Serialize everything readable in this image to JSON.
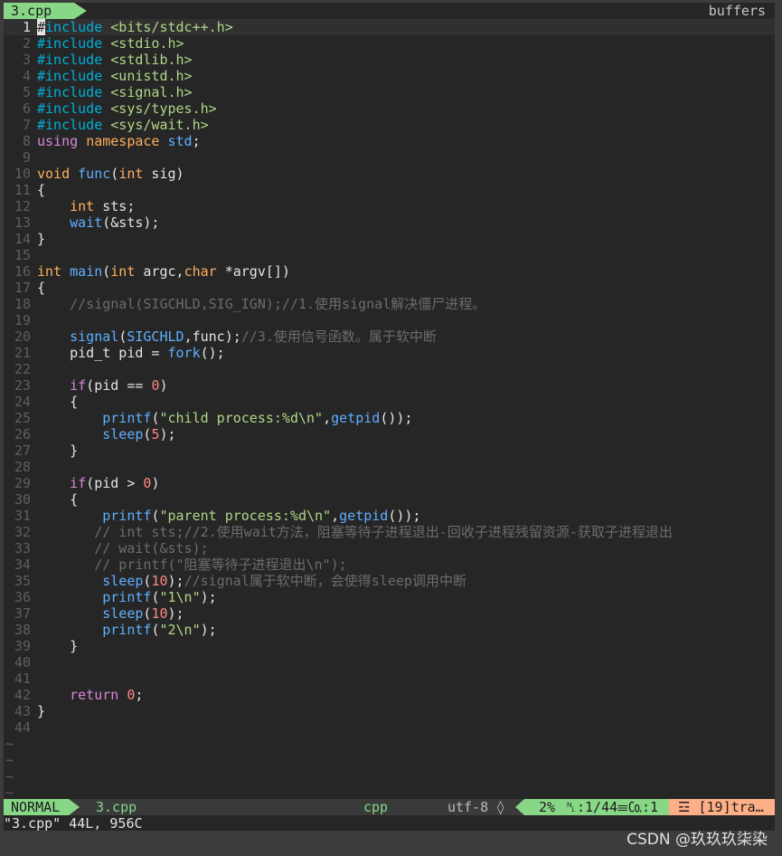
{
  "tabline": {
    "tab": "3.cpp",
    "buffers_label": "buffers"
  },
  "status": {
    "mode": "NORMAL",
    "file": "3.cpp",
    "filetype": "cpp",
    "encoding": "utf-8 ◊",
    "percent": "2%",
    "position": "␤:1/44☰",
    "column": "㏇:1",
    "warning": "☲ [19]tra…"
  },
  "cmdline": "\"3.cpp\" 44L, 956C",
  "watermark": "CSDN @玖玖玖柒染",
  "cursor_line": 1,
  "code": [
    [
      [
        "pre",
        "#include "
      ],
      [
        "inc",
        "<bits/stdc++.h>"
      ]
    ],
    [
      [
        "pre",
        "#include "
      ],
      [
        "inc",
        "<stdio.h>"
      ]
    ],
    [
      [
        "pre",
        "#include "
      ],
      [
        "inc",
        "<stdlib.h>"
      ]
    ],
    [
      [
        "pre",
        "#include "
      ],
      [
        "inc",
        "<unistd.h>"
      ]
    ],
    [
      [
        "pre",
        "#include "
      ],
      [
        "inc",
        "<signal.h>"
      ]
    ],
    [
      [
        "pre",
        "#include "
      ],
      [
        "inc",
        "<sys/types.h>"
      ]
    ],
    [
      [
        "pre",
        "#include "
      ],
      [
        "inc",
        "<sys/wait.h>"
      ]
    ],
    [
      [
        "kw",
        "using"
      ],
      [
        "plain",
        " "
      ],
      [
        "ty",
        "namespace"
      ],
      [
        "plain",
        " "
      ],
      [
        "fn",
        "std"
      ],
      [
        "plain",
        ";"
      ]
    ],
    [],
    [
      [
        "ty",
        "void"
      ],
      [
        "plain",
        " "
      ],
      [
        "fn",
        "func"
      ],
      [
        "plain",
        "("
      ],
      [
        "ty",
        "int"
      ],
      [
        "plain",
        " sig)"
      ]
    ],
    [
      [
        "plain",
        "{"
      ]
    ],
    [
      [
        "plain",
        "    "
      ],
      [
        "ty",
        "int"
      ],
      [
        "plain",
        " sts;"
      ]
    ],
    [
      [
        "plain",
        "    "
      ],
      [
        "fn",
        "wait"
      ],
      [
        "plain",
        "(&sts);"
      ]
    ],
    [
      [
        "plain",
        "}"
      ]
    ],
    [],
    [
      [
        "ty",
        "int"
      ],
      [
        "plain",
        " "
      ],
      [
        "fn",
        "main"
      ],
      [
        "plain",
        "("
      ],
      [
        "ty",
        "int"
      ],
      [
        "plain",
        " argc,"
      ],
      [
        "ty",
        "char"
      ],
      [
        "plain",
        " *argv[])"
      ]
    ],
    [
      [
        "plain",
        "{"
      ]
    ],
    [
      [
        "plain",
        "    "
      ],
      [
        "cmt",
        "//signal(SIGCHLD,SIG_IGN);//1.使用signal解决僵尸进程。"
      ]
    ],
    [],
    [
      [
        "plain",
        "    "
      ],
      [
        "fn",
        "signal"
      ],
      [
        "plain",
        "("
      ],
      [
        "fn",
        "SIGCHLD"
      ],
      [
        "plain",
        ",func);"
      ],
      [
        "cmt",
        "//3.使用信号函数。属于软中断"
      ]
    ],
    [
      [
        "plain",
        "    pid_t pid = "
      ],
      [
        "fn",
        "fork"
      ],
      [
        "plain",
        "();"
      ]
    ],
    [],
    [
      [
        "plain",
        "    "
      ],
      [
        "kw",
        "if"
      ],
      [
        "plain",
        "(pid == "
      ],
      [
        "num",
        "0"
      ],
      [
        "plain",
        ")"
      ]
    ],
    [
      [
        "plain",
        "    {"
      ]
    ],
    [
      [
        "plain",
        "        "
      ],
      [
        "fn",
        "printf"
      ],
      [
        "plain",
        "("
      ],
      [
        "str",
        "\"child process:%d\\n\""
      ],
      [
        "plain",
        ","
      ],
      [
        "fn",
        "getpid"
      ],
      [
        "plain",
        "());"
      ]
    ],
    [
      [
        "plain",
        "        "
      ],
      [
        "fn",
        "sleep"
      ],
      [
        "plain",
        "("
      ],
      [
        "num",
        "5"
      ],
      [
        "plain",
        ");"
      ]
    ],
    [
      [
        "plain",
        "    }"
      ]
    ],
    [],
    [
      [
        "plain",
        "    "
      ],
      [
        "kw",
        "if"
      ],
      [
        "plain",
        "(pid > "
      ],
      [
        "num",
        "0"
      ],
      [
        "plain",
        ")"
      ]
    ],
    [
      [
        "plain",
        "    {"
      ]
    ],
    [
      [
        "plain",
        "        "
      ],
      [
        "fn",
        "printf"
      ],
      [
        "plain",
        "("
      ],
      [
        "str",
        "\"parent process:%d\\n\""
      ],
      [
        "plain",
        ","
      ],
      [
        "fn",
        "getpid"
      ],
      [
        "plain",
        "());"
      ]
    ],
    [
      [
        "plain",
        "       "
      ],
      [
        "cmt",
        "// int sts;//2.使用wait方法，阻塞等待子进程退出-回收子进程残留资源-获取子进程退出"
      ]
    ],
    [
      [
        "plain",
        "       "
      ],
      [
        "cmt",
        "// wait(&sts);"
      ]
    ],
    [
      [
        "plain",
        "       "
      ],
      [
        "cmt",
        "// printf(\"阻塞等待子进程退出\\n\");"
      ]
    ],
    [
      [
        "plain",
        "        "
      ],
      [
        "fn",
        "sleep"
      ],
      [
        "plain",
        "("
      ],
      [
        "num",
        "10"
      ],
      [
        "plain",
        ");"
      ],
      [
        "cmt",
        "//signal属于软中断，会使得sleep调用中断"
      ]
    ],
    [
      [
        "plain",
        "        "
      ],
      [
        "fn",
        "printf"
      ],
      [
        "plain",
        "("
      ],
      [
        "str",
        "\"1\\n\""
      ],
      [
        "plain",
        ");"
      ]
    ],
    [
      [
        "plain",
        "        "
      ],
      [
        "fn",
        "sleep"
      ],
      [
        "plain",
        "("
      ],
      [
        "num",
        "10"
      ],
      [
        "plain",
        ");"
      ]
    ],
    [
      [
        "plain",
        "        "
      ],
      [
        "fn",
        "printf"
      ],
      [
        "plain",
        "("
      ],
      [
        "str",
        "\"2\\n\""
      ],
      [
        "plain",
        ");"
      ]
    ],
    [
      [
        "plain",
        "    }"
      ]
    ],
    [],
    [],
    [
      [
        "plain",
        "    "
      ],
      [
        "kw",
        "return"
      ],
      [
        "plain",
        " "
      ],
      [
        "num",
        "0"
      ],
      [
        "plain",
        ";"
      ]
    ],
    [
      [
        "plain",
        "}"
      ]
    ],
    []
  ],
  "tilde_rows": 4,
  "tilde_char": "~"
}
